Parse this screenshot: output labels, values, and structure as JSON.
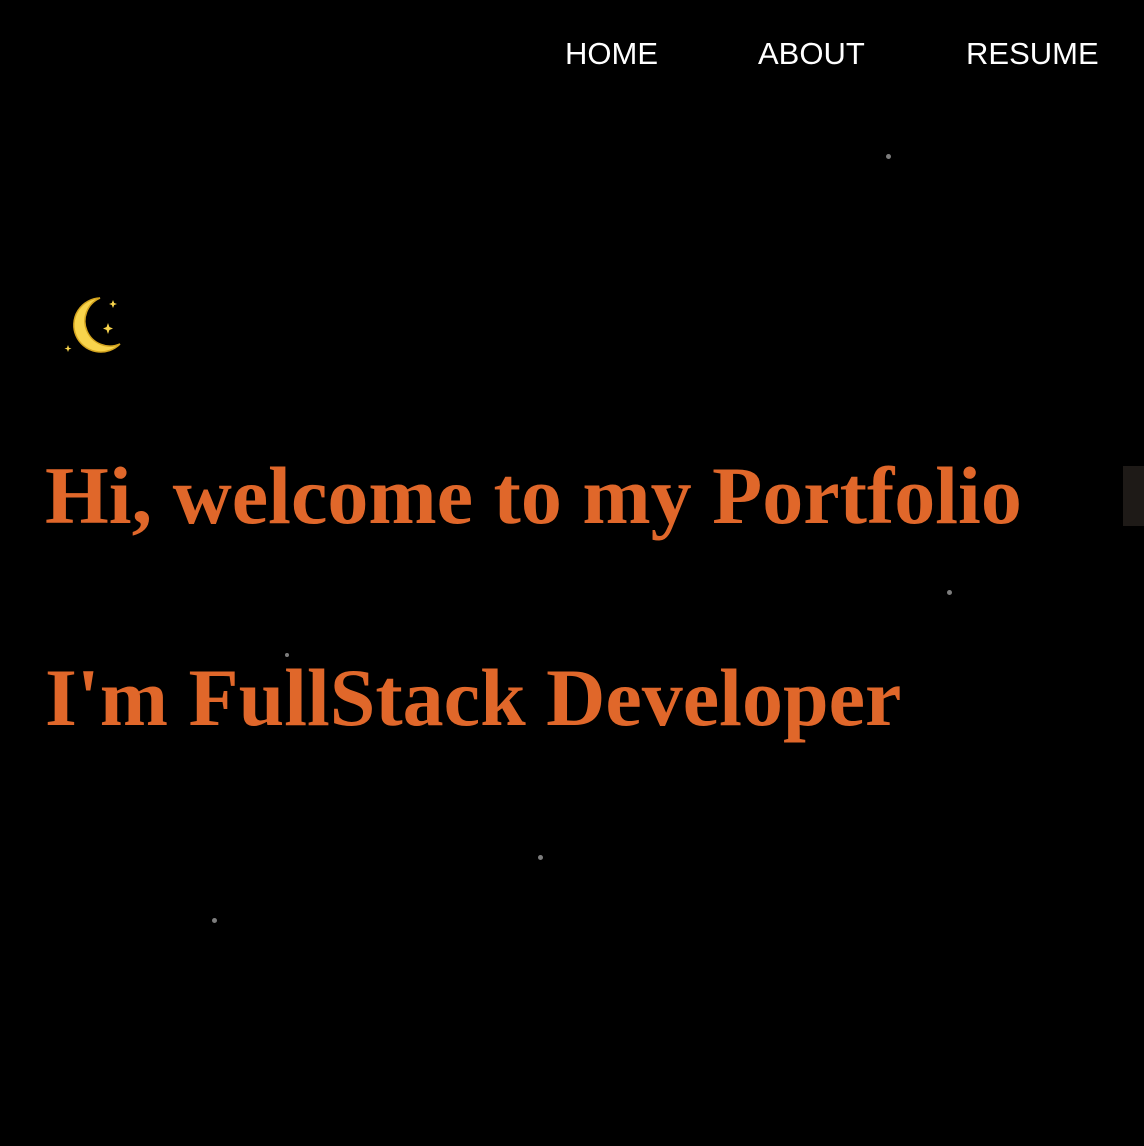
{
  "nav": {
    "items": [
      {
        "label": "HOME"
      },
      {
        "label": "ABOUT"
      },
      {
        "label": "RESUME"
      }
    ]
  },
  "hero": {
    "theme_icon": "moon-stars-icon",
    "greeting": "Hi, welcome to my Portfolio",
    "role": "I'm FullStack Developer"
  },
  "colors": {
    "background": "#000000",
    "accent": "#e0672a",
    "nav_text": "#ffffff",
    "moon": "#f8d44c",
    "star": "#7d7d7d"
  }
}
